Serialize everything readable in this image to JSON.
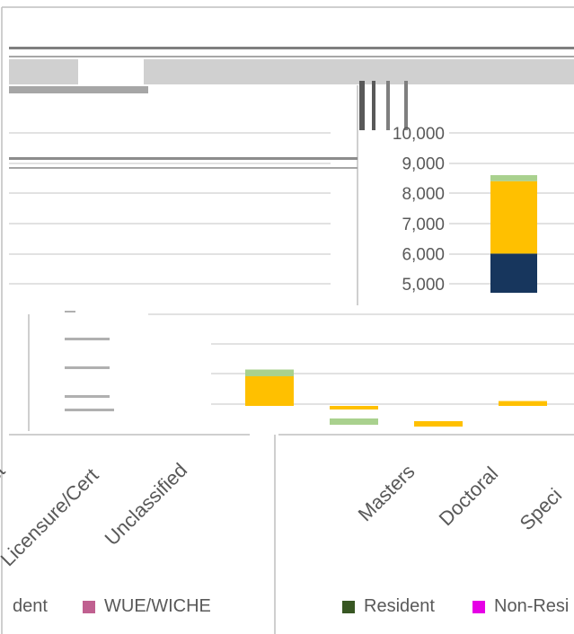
{
  "chart_data": [
    {
      "type": "bar",
      "stacked": true,
      "yticks": [
        "10,000",
        "9,000",
        "8,000",
        "7,000",
        "6,000",
        "5,000"
      ],
      "ylim": [
        4700,
        10000
      ],
      "series": [
        {
          "color": "#17365d",
          "values": [
            6000
          ]
        },
        {
          "color": "#ffc000",
          "values": [
            2400
          ]
        },
        {
          "color": "#a9d18e",
          "values": [
            200
          ]
        }
      ]
    },
    {
      "type": "bar",
      "stacked": true,
      "categories": [
        "Specialist",
        "Licensure/Cert",
        "Unclassified",
        "",
        "Masters",
        "Doctoral",
        "Specialist"
      ],
      "ylim": [
        0,
        1
      ],
      "series": [
        {
          "color": "#17365d",
          "values": [
            0,
            0,
            0,
            0,
            0,
            0,
            0
          ]
        },
        {
          "color": "#ffc000",
          "values": [
            0,
            0,
            0,
            0.11,
            0.015,
            0.02,
            0.018
          ]
        },
        {
          "color": "#a9d18e",
          "values": [
            0,
            0,
            0,
            0.025,
            0.007,
            0,
            0
          ]
        }
      ]
    }
  ],
  "labels": {
    "cat_specialist_left": "ialist",
    "cat_licensure": "Licensure/Cert",
    "cat_unclassified": "Unclassified",
    "cat_masters": "Masters",
    "cat_doctoral": "Doctoral",
    "cat_specialist_right": "Speci"
  },
  "legend_left": [
    {
      "label": "dent",
      "color": "#3b5e1f"
    },
    {
      "label": "WUE/WICHE",
      "color": "#c06090"
    }
  ],
  "legend_right": [
    {
      "label": "Resident",
      "color": "#385723"
    },
    {
      "label": "Non-Resi",
      "color": "#e600e6"
    }
  ]
}
